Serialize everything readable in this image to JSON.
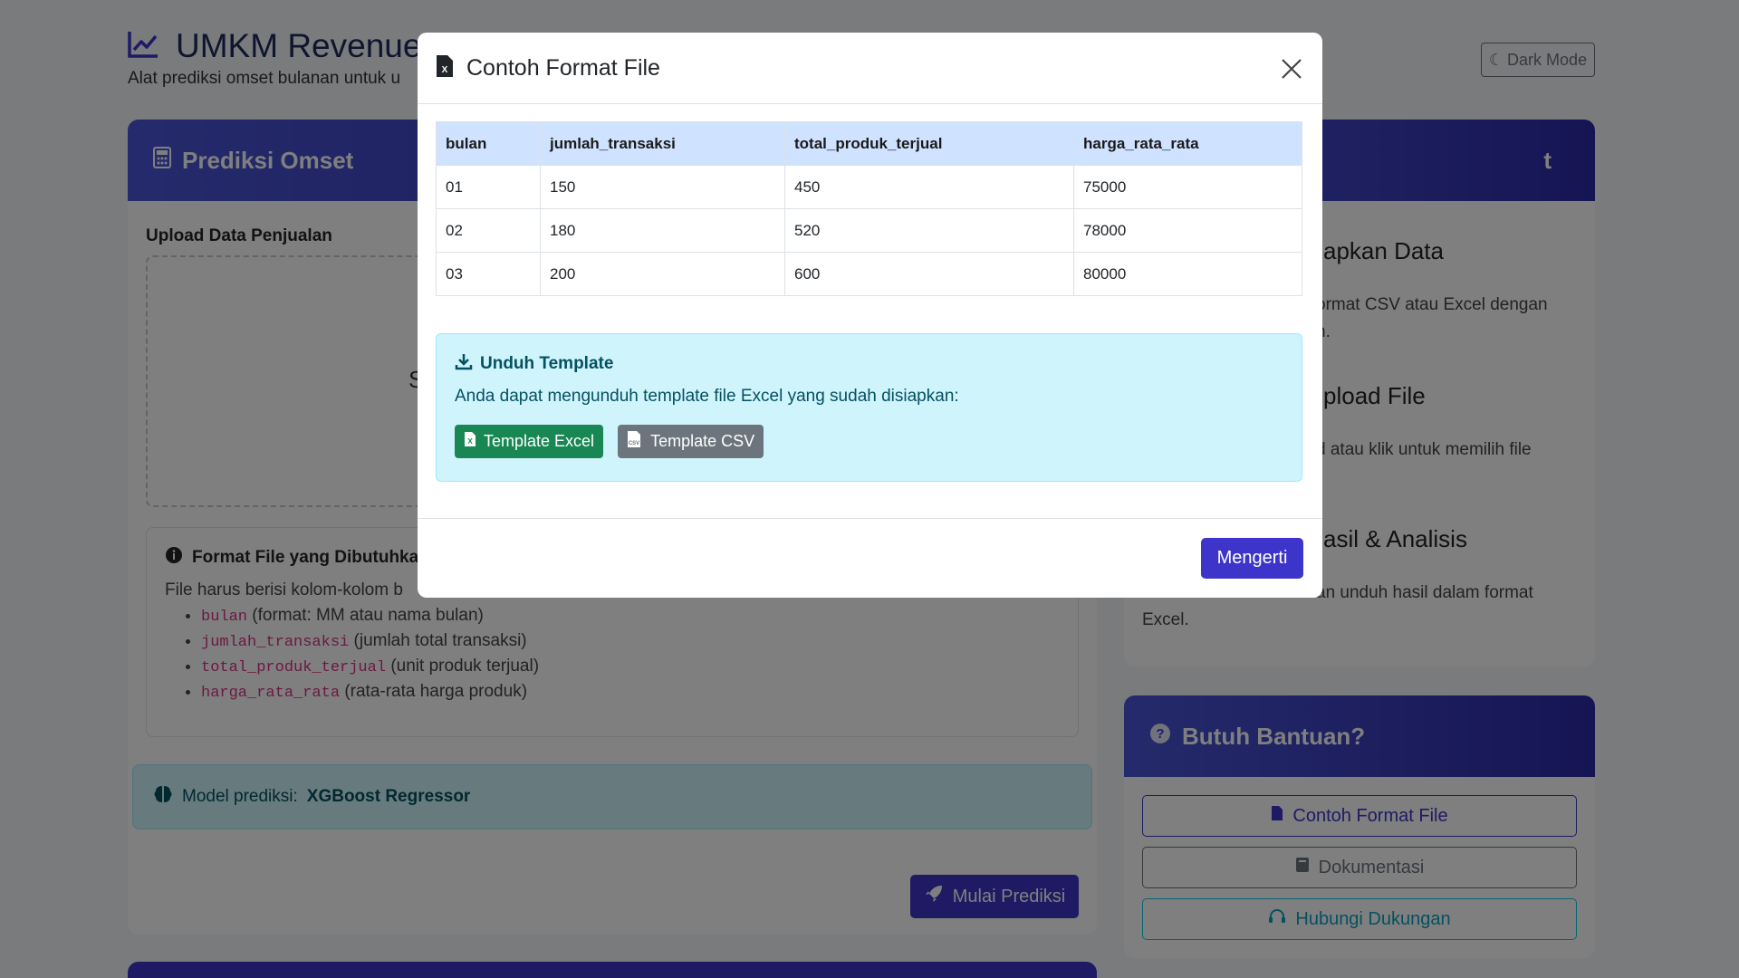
{
  "header": {
    "title": "UMKM Revenue",
    "subtitle": "Alat prediksi omset bulanan untuk u",
    "dark_mode": "Dark Mode"
  },
  "left": {
    "card_title": "Prediksi Omset",
    "upload_label": "Upload Data Penjualan",
    "dropzone_partial": "S",
    "format_title": "Format File yang Dibutuhka",
    "format_desc": "File harus berisi kolom-kolom b",
    "format_items": [
      {
        "code": "bulan",
        "desc": "(format: MM atau nama bulan)"
      },
      {
        "code": "jumlah_transaksi",
        "desc": "(jumlah total transaksi)"
      },
      {
        "code": "total_produk_terjual",
        "desc": "(unit produk terjual)"
      },
      {
        "code": "harga_rata_rata",
        "desc": "(rata-rata harga produk)"
      }
    ],
    "model_label": "Model prediksi:",
    "model_name": "XGBoost Regressor",
    "start_button": "Mulai Prediksi"
  },
  "right": {
    "card_title_partial": "t",
    "step1_title": "apkan Data",
    "step1_desc_l1": "ormat CSV atau Excel dengan",
    "step1_desc_l2": "n.",
    "step2_title": "pload File",
    "step2_desc": "d atau klik untuk memilih file",
    "step3_title": "asil & Analisis",
    "step3_desc_l1": "an unduh hasil dalam format",
    "step3_desc_l2": "Excel."
  },
  "help": {
    "title": "Butuh Bantuan?",
    "buttons": {
      "format": "Contoh Format File",
      "docs": "Dokumentasi",
      "support": "Hubungi Dukungan"
    }
  },
  "modal": {
    "title": "Contoh Format File",
    "table": {
      "headers": [
        "bulan",
        "jumlah_transaksi",
        "total_produk_terjual",
        "harga_rata_rata"
      ],
      "rows": [
        [
          "01",
          "150",
          "450",
          "75000"
        ],
        [
          "02",
          "180",
          "520",
          "78000"
        ],
        [
          "03",
          "200",
          "600",
          "80000"
        ]
      ]
    },
    "template_title": "Unduh Template",
    "template_desc": "Anda dapat mengunduh template file Excel yang sudah disiapkan:",
    "template_excel": "Template Excel",
    "template_csv": "Template CSV",
    "ok_button": "Mengerti"
  },
  "colors": {
    "primary": "#3d35c9",
    "excel_green": "#198754",
    "csv_gray": "#6c757d",
    "info_bg": "#cff4fc"
  }
}
